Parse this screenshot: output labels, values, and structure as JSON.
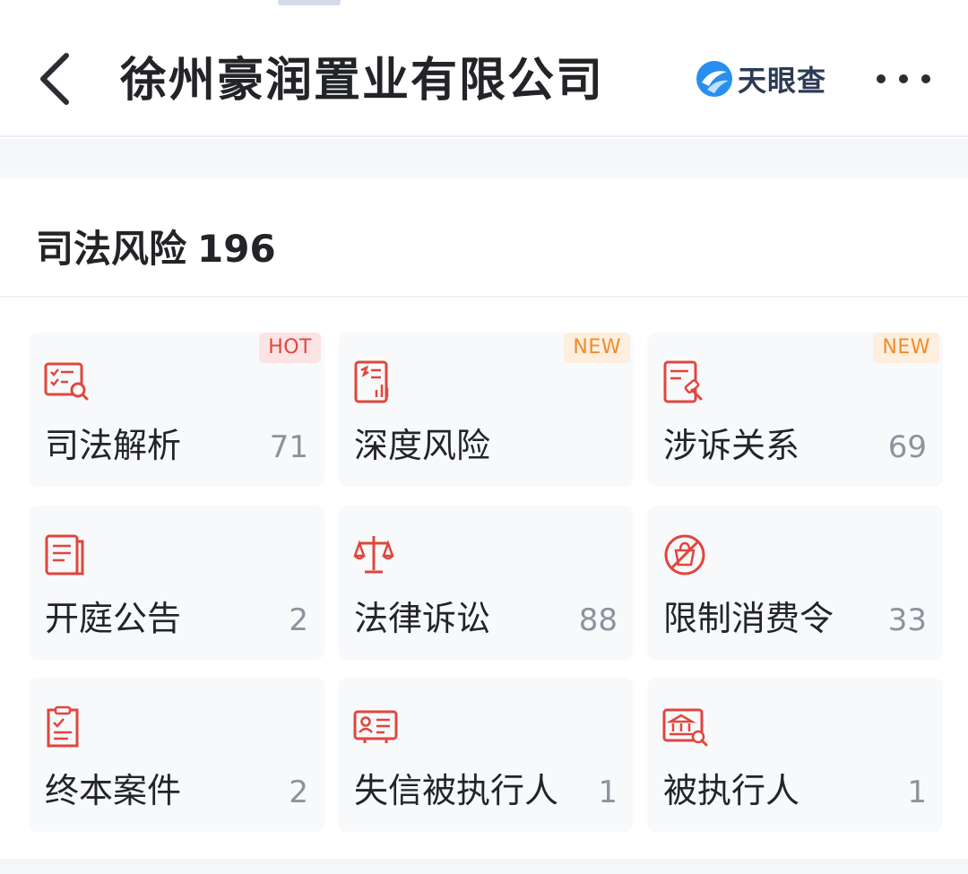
{
  "header": {
    "title": "徐州豪润置业有限公司",
    "brand_name": "天眼查"
  },
  "section": {
    "title": "司法风险",
    "count": "196"
  },
  "tiles": [
    {
      "label": "司法解析",
      "count": "71",
      "badge": "HOT",
      "icon": "legal-analysis-icon"
    },
    {
      "label": "深度风险",
      "count": "",
      "badge": "NEW",
      "icon": "deep-risk-icon"
    },
    {
      "label": "涉诉关系",
      "count": "69",
      "badge": "NEW",
      "icon": "litigation-relation-icon"
    },
    {
      "label": "开庭公告",
      "count": "2",
      "badge": "",
      "icon": "court-notice-icon"
    },
    {
      "label": "法律诉讼",
      "count": "88",
      "badge": "",
      "icon": "scales-icon"
    },
    {
      "label": "限制消费令",
      "count": "33",
      "badge": "",
      "icon": "no-spending-icon"
    },
    {
      "label": "终本案件",
      "count": "2",
      "badge": "",
      "icon": "closed-case-icon"
    },
    {
      "label": "失信被执行人",
      "count": "1",
      "badge": "",
      "icon": "dishonest-debtor-icon"
    },
    {
      "label": "被执行人",
      "count": "1",
      "badge": "",
      "icon": "debtor-icon"
    }
  ],
  "colors": {
    "icon_red": "#e0463d",
    "brand_blue": "#2a8df0",
    "count_gray": "#8d939d",
    "tile_bg": "#f8f9fb"
  }
}
